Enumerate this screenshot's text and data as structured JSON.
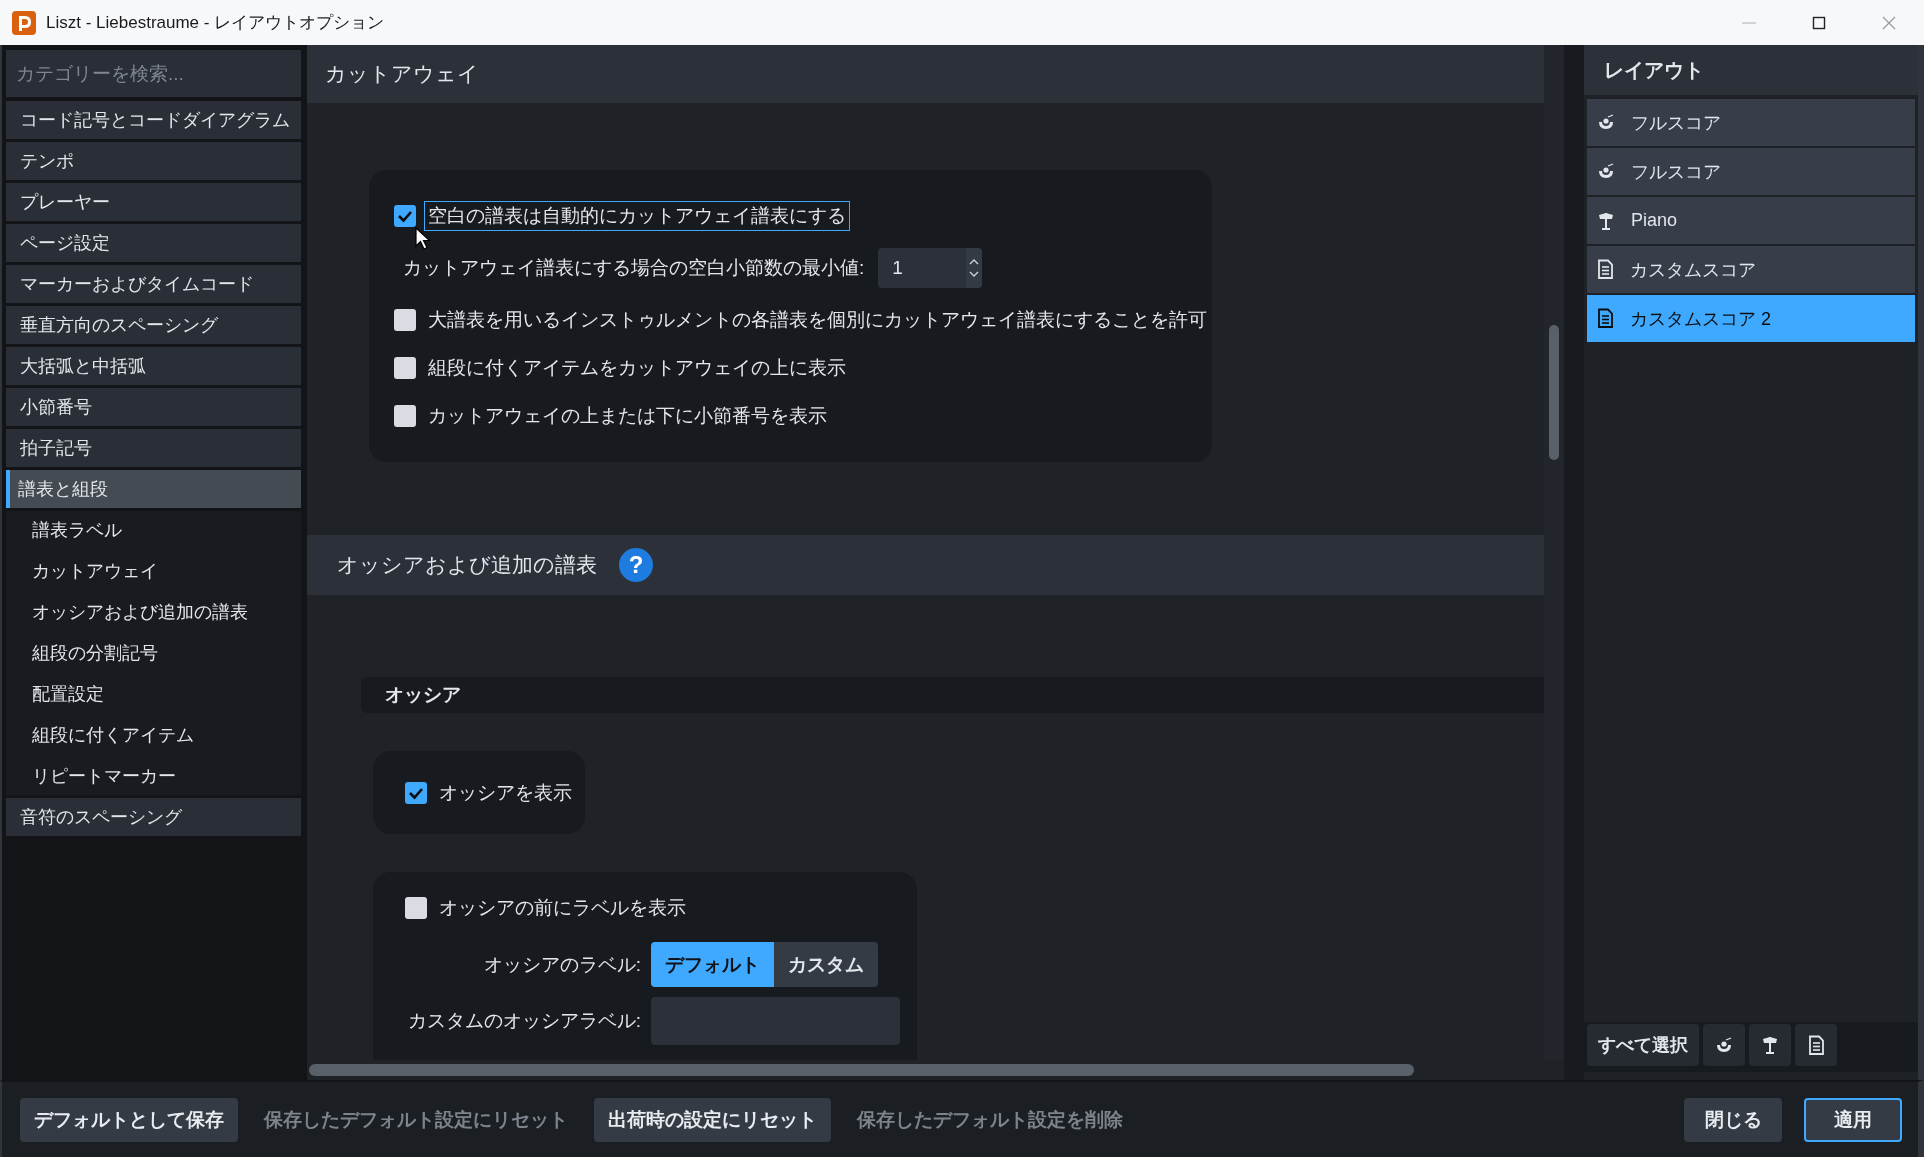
{
  "window": {
    "title": "Liszt - Liebestraume - レイアウトオプション"
  },
  "sidebar": {
    "search": {
      "placeholder": "カテゴリーを検索..."
    },
    "items": [
      {
        "label": "コード記号とコードダイアグラム",
        "selected": false
      },
      {
        "label": "テンポ",
        "selected": false
      },
      {
        "label": "プレーヤー",
        "selected": false
      },
      {
        "label": "ページ設定",
        "selected": false
      },
      {
        "label": "マーカーおよびタイムコード",
        "selected": false
      },
      {
        "label": "垂直方向のスペーシング",
        "selected": false
      },
      {
        "label": "大括弧と中括弧",
        "selected": false
      },
      {
        "label": "小節番号",
        "selected": false
      },
      {
        "label": "拍子記号",
        "selected": false
      },
      {
        "label": "譜表と組段",
        "selected": true,
        "children": [
          {
            "label": "譜表ラベル",
            "selected": false
          },
          {
            "label": "カットアウェイ",
            "selected": false
          },
          {
            "label": "オッシアおよび追加の譜表",
            "selected": false
          },
          {
            "label": "組段の分割記号",
            "selected": false
          },
          {
            "label": "配置設定",
            "selected": false
          },
          {
            "label": "組段に付くアイテム",
            "selected": false
          },
          {
            "label": "リピートマーカー",
            "selected": false
          }
        ]
      },
      {
        "label": "音符のスペーシング",
        "selected": false
      }
    ]
  },
  "cutaway": {
    "title": "カットアウェイ",
    "options": [
      {
        "kind": "checkbox",
        "label": "空白の譜表は自動的にカットアウェイ譜表にする",
        "checked": true,
        "focused": true
      },
      {
        "kind": "number",
        "label": "カットアウェイ譜表にする場合の空白小節数の最小値:",
        "value": "1"
      },
      {
        "kind": "checkbox",
        "label": "大譜表を用いるインストゥルメントの各譜表を個別にカットアウェイ譜表にすることを許可",
        "checked": false,
        "focused": false
      },
      {
        "kind": "checkbox",
        "label": "組段に付くアイテムをカットアウェイの上に表示",
        "checked": false,
        "focused": false
      },
      {
        "kind": "checkbox",
        "label": "カットアウェイの上または下に小節番号を表示",
        "checked": false,
        "focused": false
      }
    ]
  },
  "ossia": {
    "title": "オッシアおよび追加の譜表",
    "help": "?",
    "subsection": "オッシア",
    "show": {
      "label": "オッシアを表示",
      "checked": true
    },
    "label_before": {
      "label": "オッシアの前にラベルを表示",
      "checked": false
    },
    "label_type": {
      "label": "オッシアのラベル:",
      "options": [
        {
          "label": "デフォルト",
          "selected": true
        },
        {
          "label": "カスタム",
          "selected": false
        }
      ]
    },
    "custom_label": {
      "label": "カスタムのオッシアラベル:"
    }
  },
  "layouts": {
    "title": "レイアウト",
    "items": [
      {
        "label": "フルスコア",
        "kind": "full_score",
        "selected": false
      },
      {
        "label": "フルスコア",
        "kind": "full_score",
        "selected": false
      },
      {
        "label": "Piano",
        "kind": "part",
        "selected": false
      },
      {
        "label": "カスタムスコア",
        "kind": "custom",
        "selected": false
      },
      {
        "label": "カスタムスコア 2",
        "kind": "custom",
        "selected": true
      }
    ],
    "select_all": "すべて選択",
    "filters": [
      {
        "kind": "full_score"
      },
      {
        "kind": "part"
      },
      {
        "kind": "custom"
      }
    ]
  },
  "footer": {
    "left": [
      {
        "label": "デフォルトとして保存",
        "disabled": false
      },
      {
        "label": "保存したデフォルト設定にリセット",
        "disabled": true
      },
      {
        "label": "出荷時の設定にリセット",
        "disabled": false
      },
      {
        "label": "保存したデフォルト設定を削除",
        "disabled": true
      }
    ],
    "right": [
      {
        "label": "閉じる",
        "primary": false
      },
      {
        "label": "適用",
        "primary": true
      }
    ]
  }
}
